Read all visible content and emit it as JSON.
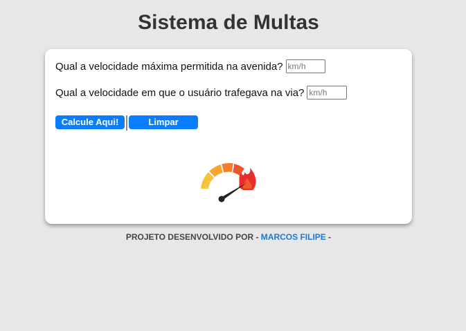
{
  "header": {
    "title": "Sistema de Multas"
  },
  "form": {
    "max_speed_label": "Qual a velocidade máxima permitida na avenida?",
    "max_speed_placeholder": "km/h",
    "max_speed_value": "",
    "user_speed_label": "Qual a velocidade em que o usuário trafegava na via?",
    "user_speed_placeholder": "km/h",
    "user_speed_value": "",
    "calc_button": "Calcule Aqui!",
    "clear_button": "Limpar"
  },
  "gauge": {
    "icon": "speedometer-flame-icon",
    "colors": [
      "#f7b733",
      "#f58a2b",
      "#ef4b2b",
      "#e82d2d"
    ]
  },
  "footer": {
    "prefix": "PROJETO DESENVOLVIDO POR -",
    "author_link": "MARCOS FILIPE",
    "suffix": "-"
  }
}
